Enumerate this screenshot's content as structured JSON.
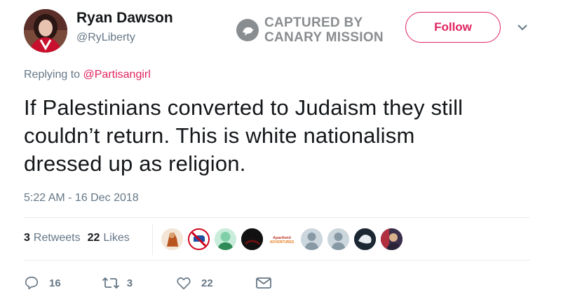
{
  "author": {
    "name": "Ryan Dawson",
    "handle": "@RyLiberty"
  },
  "stamp": {
    "line1": "CAPTURED BY",
    "line2": "CANARY MISSION"
  },
  "follow_label": "Follow",
  "reply": {
    "prefix": "Replying to",
    "mention": "@Partisangirl"
  },
  "tweet": {
    "line1": "If Palestinians converted to Judaism they still",
    "line2": "couldn’t return. This is white nationalism",
    "line3": "dressed up as religion."
  },
  "timestamp": "5:22 AM - 16 Dec 2018",
  "stats": {
    "retweets_count": "3",
    "retweets_label": "Retweets",
    "likes_count": "22",
    "likes_label": "Likes"
  },
  "liker_badge": {
    "line1": "Apartheid",
    "line2": "ADVENTURES"
  },
  "actions": {
    "replies": "16",
    "retweets": "3",
    "likes": "22"
  },
  "colors": {
    "accent": "#e0245e",
    "muted": "#657786",
    "text": "#14171a",
    "stamp": "#8a8d90"
  }
}
